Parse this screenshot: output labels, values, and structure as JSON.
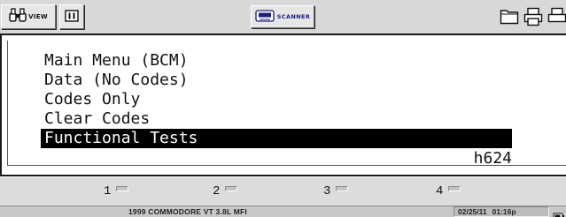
{
  "toolbar": {
    "view_label": "VIEW",
    "hold_icon": "pause-bars-icon",
    "scanner_label": "SCANNER",
    "right_icons": [
      "folder-icon",
      "printer-icon",
      "printer-icon"
    ]
  },
  "screen": {
    "menu_items": [
      {
        "label": "Main Menu (BCM)",
        "selected": false
      },
      {
        "label": "Data (No Codes)",
        "selected": false
      },
      {
        "label": "Codes Only",
        "selected": false
      },
      {
        "label": "Clear Codes",
        "selected": false
      },
      {
        "label": "Functional Tests",
        "selected": true
      }
    ],
    "code": "h624"
  },
  "softkeys": [
    {
      "number": "1"
    },
    {
      "number": "2"
    },
    {
      "number": "3"
    },
    {
      "number": "4"
    }
  ],
  "status": {
    "vehicle": "1999 COMMODORE VT 3.8L MFI",
    "date": "02/25/11",
    "time": "01:16p"
  },
  "colors": {
    "background": "#d8d8d8",
    "screen": "#ffffff",
    "selection": "#000000",
    "scanner_text": "#1c1c7a"
  }
}
